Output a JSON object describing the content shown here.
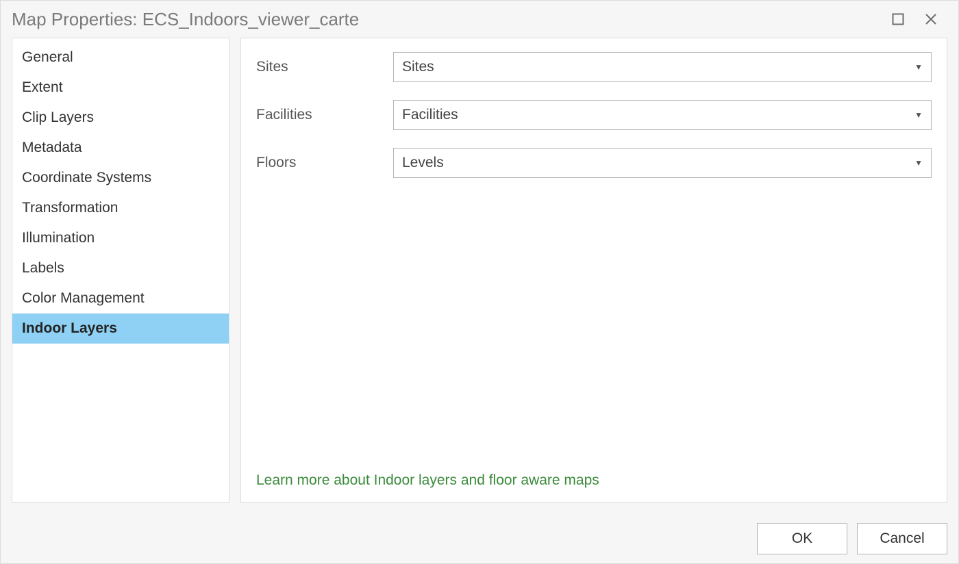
{
  "titlebar": {
    "title": "Map Properties: ECS_Indoors_viewer_carte"
  },
  "sidebar": {
    "items": [
      {
        "label": "General",
        "selected": false
      },
      {
        "label": "Extent",
        "selected": false
      },
      {
        "label": "Clip Layers",
        "selected": false
      },
      {
        "label": "Metadata",
        "selected": false
      },
      {
        "label": "Coordinate Systems",
        "selected": false
      },
      {
        "label": "Transformation",
        "selected": false
      },
      {
        "label": "Illumination",
        "selected": false
      },
      {
        "label": "Labels",
        "selected": false
      },
      {
        "label": "Color Management",
        "selected": false
      },
      {
        "label": "Indoor Layers",
        "selected": true
      }
    ]
  },
  "form": {
    "sites_label": "Sites",
    "sites_value": "Sites",
    "facilities_label": "Facilities",
    "facilities_value": "Facilities",
    "floors_label": "Floors",
    "floors_value": "Levels"
  },
  "link_text": "Learn more about Indoor layers and floor aware maps",
  "buttons": {
    "ok": "OK",
    "cancel": "Cancel"
  }
}
